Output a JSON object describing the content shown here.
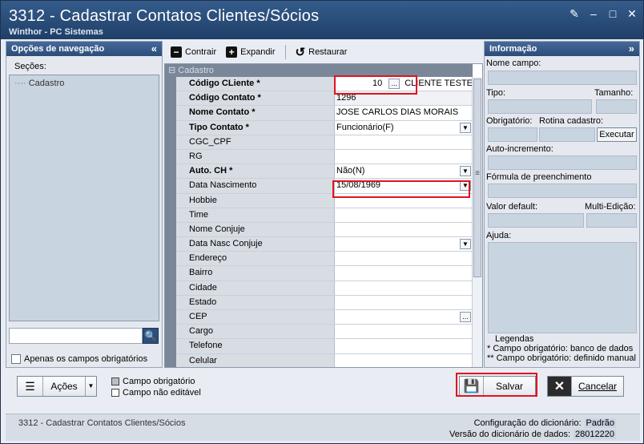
{
  "window": {
    "title": "3312 - Cadastrar Contatos Clientes/Sócios",
    "subtitle": "Winthor - PC Sistemas"
  },
  "nav": {
    "header": "Opções de navegação",
    "sections_label": "Seções:",
    "tree_item": "Cadastro",
    "only_required_label": "Apenas os campos obrigatórios"
  },
  "toolbar": {
    "collapse_label": "Contrair",
    "expand_label": "Expandir",
    "restore_label": "Restaurar"
  },
  "grid": {
    "group_label": "Cadastro",
    "client_code": "10",
    "client_name": "CLIENTE TESTE",
    "rows": [
      {
        "label": "Código CLiente *",
        "value": "",
        "required": true
      },
      {
        "label": "Código Contato *",
        "value": "1296",
        "required": true
      },
      {
        "label": "Nome Contato *",
        "value": "JOSE CARLOS DIAS MORAIS",
        "required": true
      },
      {
        "label": "Tipo Contato *",
        "value": "Funcionário(F)",
        "required": true
      },
      {
        "label": "CGC_CPF",
        "value": ""
      },
      {
        "label": "RG",
        "value": ""
      },
      {
        "label": "Auto. CH *",
        "value": "Não(N)",
        "required": true
      },
      {
        "label": "Data Nascimento",
        "value": "15/08/1969"
      },
      {
        "label": "Hobbie",
        "value": ""
      },
      {
        "label": "Time",
        "value": ""
      },
      {
        "label": "Nome Conjuje",
        "value": ""
      },
      {
        "label": "Data Nasc Conjuje",
        "value": ""
      },
      {
        "label": "Endereço",
        "value": ""
      },
      {
        "label": "Bairro",
        "value": ""
      },
      {
        "label": "Cidade",
        "value": ""
      },
      {
        "label": "Estado",
        "value": ""
      },
      {
        "label": "CEP",
        "value": ""
      },
      {
        "label": "Cargo",
        "value": ""
      },
      {
        "label": "Telefone",
        "value": ""
      },
      {
        "label": "Celular",
        "value": ""
      }
    ]
  },
  "info": {
    "header": "Informação",
    "field_name_label": "Nome campo:",
    "type_label": "Tipo:",
    "size_label": "Tamanho:",
    "required_label": "Obrigatório:",
    "routine_label": "Rotina cadastro:",
    "execute_label": "Executar",
    "autoinc_label": "Auto-incremento:",
    "formula_label": "Fórmula de preenchimento",
    "default_label": "Valor default:",
    "multiedit_label": "Multi-Edição:",
    "help_label": "Ajuda:",
    "legend_title": "Legendas",
    "legend_1": "* Campo obrigatório: banco de dados",
    "legend_2": "** Campo obrigatório: definido manual"
  },
  "bottom": {
    "actions_label": "Ações",
    "legend_required": "Campo obrigatório",
    "legend_readonly": "Campo não editável",
    "save_label": "Salvar",
    "cancel_label": "Cancelar"
  },
  "status": {
    "routine": "3312 - Cadastrar Contatos Clientes/Sócios",
    "dict_config_label": "Configuração do dicionário:",
    "dict_config_value": "Padrão",
    "dict_version_label": "Versão do dicionário de dados:",
    "dict_version_value": "28012220"
  },
  "colors": {
    "title_bar": "#1f3f68",
    "highlight": "#e0141e",
    "panel_header": "#2b4d79"
  }
}
